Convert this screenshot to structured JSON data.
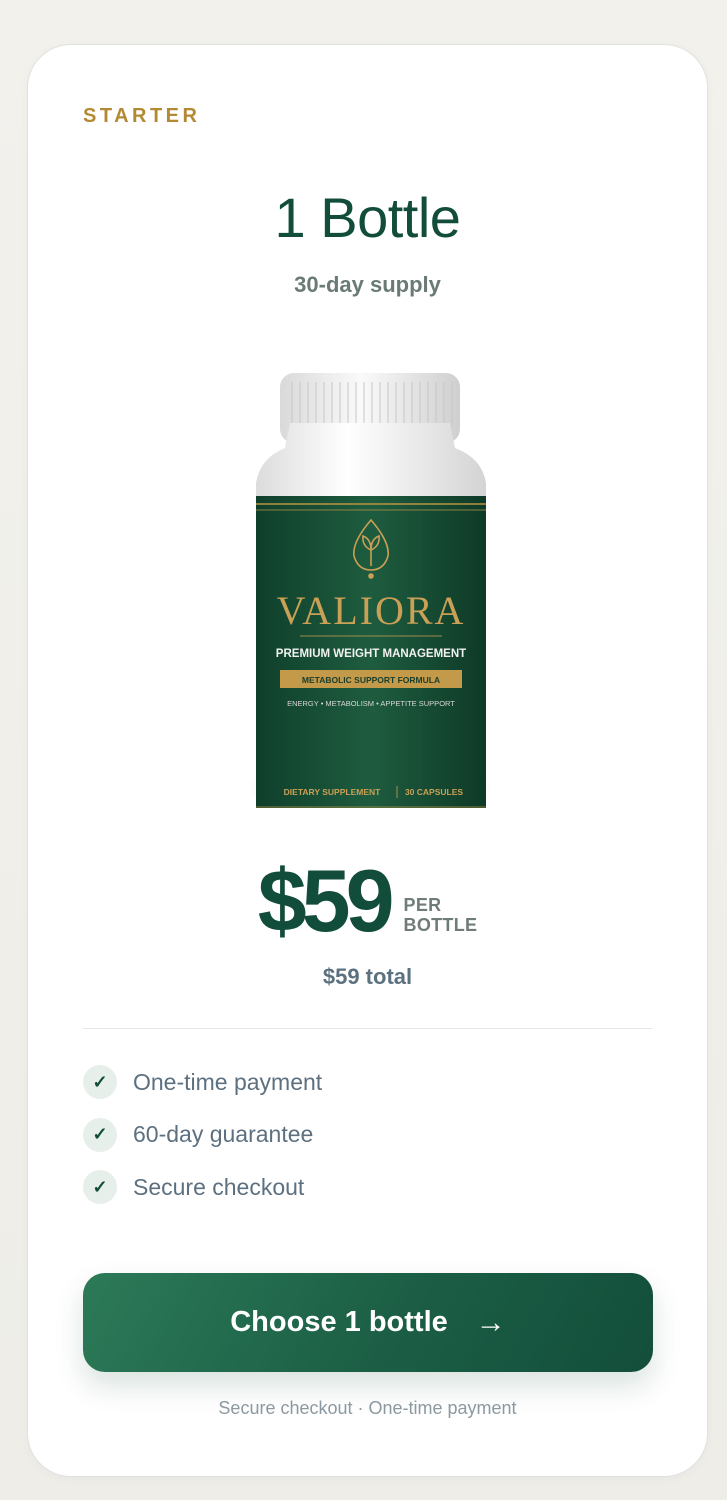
{
  "plan": {
    "tier": "STARTER",
    "title": "1 Bottle",
    "subtitle": "30-day supply"
  },
  "product": {
    "brand": "VALIORA",
    "tagline": "PREMIUM WEIGHT MANAGEMENT",
    "formula": "METABOLIC SUPPORT FORMULA",
    "benefits": "ENERGY • METABOLISM • APPETITE SUPPORT",
    "supplement": "DIETARY SUPPLEMENT",
    "capsules": "30 CAPSULES",
    "logo_icon": "leaf-drop-icon"
  },
  "pricing": {
    "price": "$59",
    "per_line1": "PER",
    "per_line2": "BOTTLE",
    "total": "$59 total"
  },
  "features": [
    {
      "icon": "check-icon",
      "label": "One-time payment"
    },
    {
      "icon": "check-icon",
      "label": "60-day guarantee"
    },
    {
      "icon": "check-icon",
      "label": "Secure checkout"
    }
  ],
  "cta": {
    "label": "Choose 1 bottle",
    "arrow": "→"
  },
  "footnote": "Secure checkout · One-time payment",
  "colors": {
    "brand_green": "#124d3b",
    "accent_gold": "#b38a33",
    "button_green": "#1b5e45",
    "check_bg": "#e6efe9"
  }
}
